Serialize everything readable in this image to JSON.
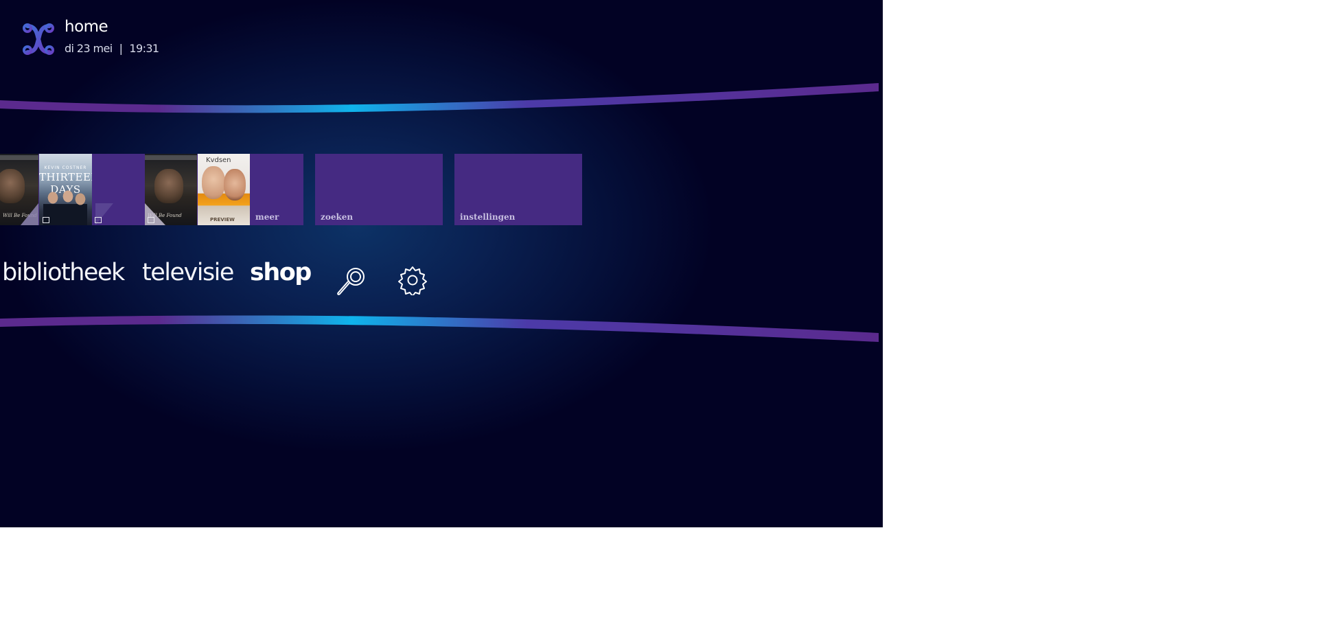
{
  "header": {
    "title": "home",
    "date": "di 23 mei",
    "separator": "|",
    "time": "19:31"
  },
  "tiles": [
    {
      "id": "meer",
      "label": "meer",
      "posters": [
        "Never Will Be Found",
        "THIRTEEN DAYS",
        "Never Will Be Found",
        "Kvdsen PREVIEW"
      ]
    },
    {
      "id": "zoeken",
      "label": "zoeken"
    },
    {
      "id": "instellingen",
      "label": "instellingen"
    }
  ],
  "posters": {
    "dark_caption": "Will Be Found",
    "days_title": "THIRTEEN DAYS",
    "days_small": "KEVIN COSTNER",
    "kvb_title": "Kvdsen",
    "kvb_tag": "PREVIEW"
  },
  "nav": {
    "items": [
      "bibliotheek",
      "televisie",
      "shop"
    ],
    "active": "shop"
  },
  "icons": {
    "logo": "brand-logo-icon",
    "search": "search-icon",
    "settings": "gear-icon"
  },
  "colors": {
    "tile": "#452a82",
    "band_purple": "#5b2a8e",
    "band_cyan": "#0fb4ec"
  }
}
